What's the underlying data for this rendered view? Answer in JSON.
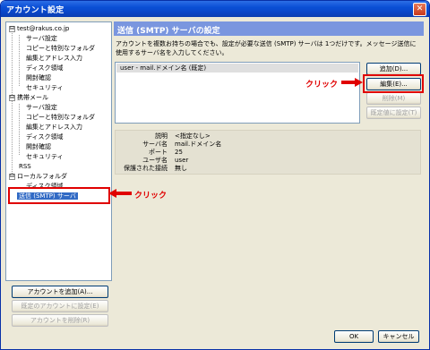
{
  "window": {
    "title": "アカウント設定",
    "close_glyph": "✕"
  },
  "tree": {
    "items": [
      {
        "label": "test@rakus.co.jp",
        "level": 0,
        "expander": "⊟"
      },
      {
        "label": "サーバ設定",
        "level": 1
      },
      {
        "label": "コピーと特別なフォルダ",
        "level": 1
      },
      {
        "label": "編集とアドレス入力",
        "level": 1
      },
      {
        "label": "ディスク領域",
        "level": 1
      },
      {
        "label": "開封確認",
        "level": 1
      },
      {
        "label": "セキュリティ",
        "level": 1
      },
      {
        "label": "携帯メール",
        "level": 0,
        "expander": "⊟"
      },
      {
        "label": "サーバ設定",
        "level": 1
      },
      {
        "label": "コピーと特別なフォルダ",
        "level": 1
      },
      {
        "label": "編集とアドレス入力",
        "level": 1
      },
      {
        "label": "ディスク領域",
        "level": 1
      },
      {
        "label": "開封確認",
        "level": 1
      },
      {
        "label": "セキュリティ",
        "level": 1
      },
      {
        "label": "RSS",
        "level": 0
      },
      {
        "label": "ローカルフォルダ",
        "level": 0,
        "expander": "⊟"
      },
      {
        "label": "ディスク領域",
        "level": 1
      },
      {
        "label": "送信 (SMTP) サーバ",
        "level": 0,
        "selected": true
      }
    ]
  },
  "left_buttons": {
    "add_account": "アカウントを追加(A)...",
    "set_default": "既定のアカウントに設定(E)",
    "delete_account": "アカウントを削除(R)"
  },
  "annotations": {
    "click_label": "クリック"
  },
  "panel": {
    "title": "送信 (SMTP) サーバの設定",
    "description": "アカウントを複数お持ちの場合でも、設定が必要な送信 (SMTP) サーバは 1つだけです。メッセージ送信に使用するサーバ名を入力してください。",
    "server_entry": "user - mail.ドメイン名 (既定)",
    "buttons": {
      "add": "追加(D)...",
      "edit": "編集(E)...",
      "remove": "削除(M)",
      "set_default": "既定値に設定(T)"
    },
    "details": [
      {
        "key": "説明",
        "value": "<指定なし>"
      },
      {
        "key": "サーバ名",
        "value": "mail.ドメイン名"
      },
      {
        "key": "ポート",
        "value": "25"
      },
      {
        "key": "ユーザ名",
        "value": "user"
      },
      {
        "key": "保護された接続",
        "value": "無し"
      }
    ]
  },
  "footer": {
    "ok": "OK",
    "cancel": "キャンセル"
  },
  "colors": {
    "accent": "#7a96df",
    "annotation": "#e00000",
    "title_bar": "#0a4fd5"
  }
}
